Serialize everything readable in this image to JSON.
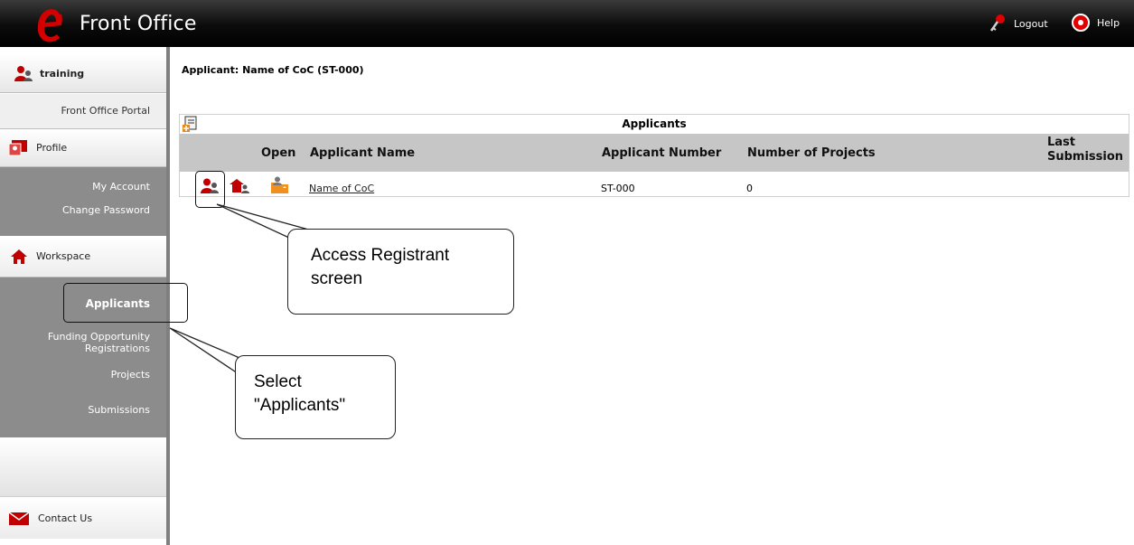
{
  "header": {
    "app_title": "Front Office",
    "logout_label": "Logout",
    "help_label": "Help",
    "colors": {
      "brand": "#c00000",
      "header_bg": "#000000"
    }
  },
  "sidebar": {
    "user": "training",
    "portal": "Front Office Portal",
    "profile": "Profile",
    "profile_links": [
      "My Account",
      "Change Password"
    ],
    "workspace": "Workspace",
    "workspace_links": [
      "Applicants",
      "Funding Opportunity Registrations",
      "Projects",
      "Submissions"
    ],
    "contact": "Contact Us"
  },
  "main": {
    "applicant_heading": "Applicant: Name of CoC (ST-000)",
    "panel_title": "Applicants",
    "columns": {
      "open": "Open",
      "name": "Applicant Name",
      "number": "Applicant Number",
      "projects": "Number of Projects",
      "last_submission": "Last Submission"
    },
    "rows": [
      {
        "name": "Name of CoC",
        "number": "ST-000",
        "projects": "0",
        "last_submission": ""
      }
    ]
  },
  "callouts": {
    "registrant": "Access Registrant screen",
    "applicants": "Select \"Applicants\""
  }
}
